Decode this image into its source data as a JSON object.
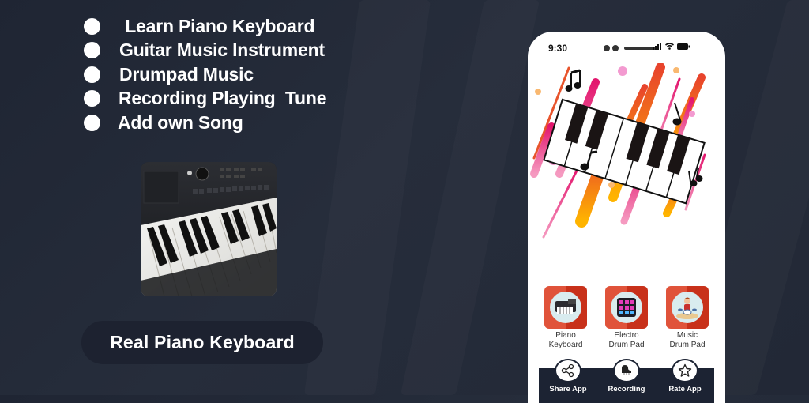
{
  "features": [
    {
      "icon": "bullet-dot",
      "label": " Learn Piano Keyboard"
    },
    {
      "icon": "bullet-dot",
      "label": "Guitar Music Instrument"
    },
    {
      "icon": "bullet-dot",
      "label": "Drumpad Music"
    },
    {
      "icon": "bullet-dot",
      "label": "Recording Playing  Tune"
    },
    {
      "icon": "bullet-dot",
      "label": "Add own Song"
    }
  ],
  "promo": {
    "image": "digital-piano-photo",
    "cta_label": "Real Piano Keyboard"
  },
  "phone": {
    "status_bar": {
      "time": "9:30",
      "icons": [
        "signal-icon",
        "wifi-icon",
        "battery-icon"
      ]
    },
    "hero_image": "piano-keys-with-music-notes",
    "tiles": [
      {
        "label_line1": "Piano",
        "label_line2": "Keyboard",
        "icon": "keyboard-icon"
      },
      {
        "label_line1": "Electro",
        "label_line2": "Drum Pad",
        "icon": "drum-pad-icon"
      },
      {
        "label_line1": "Music",
        "label_line2": "Drum Pad",
        "icon": "drummer-icon"
      }
    ],
    "nav": [
      {
        "label": "Share App",
        "icon": "share-icon"
      },
      {
        "label": "Recording",
        "icon": "piano-icon"
      },
      {
        "label": "Rate App",
        "icon": "star-icon"
      }
    ]
  },
  "colors": {
    "background": "#232a38",
    "tile_red": "#e0533a",
    "nav_dark": "#1c2333"
  }
}
